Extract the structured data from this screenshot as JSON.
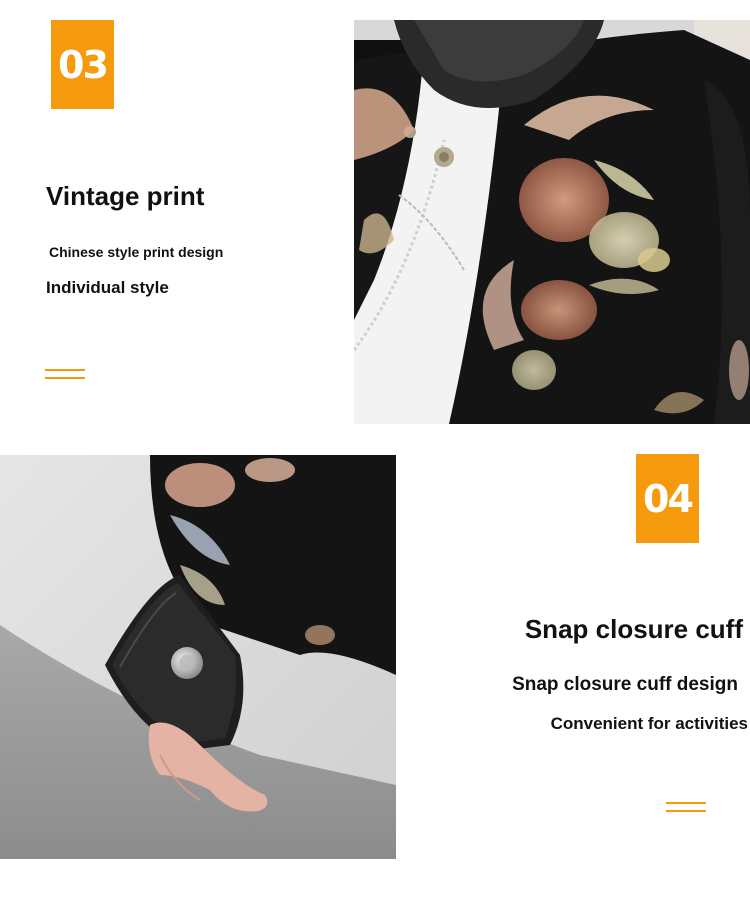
{
  "section_03": {
    "number": "03",
    "title": "Vintage print",
    "line1": "Chinese style print design",
    "line2": "Individual style"
  },
  "section_04": {
    "number": "04",
    "title": "Snap closure cuff",
    "line1": "Snap closure cuff design",
    "line2": "Convenient for activities"
  },
  "colors": {
    "accent": "#f59a0c",
    "text": "#111111",
    "background": "#ffffff"
  }
}
